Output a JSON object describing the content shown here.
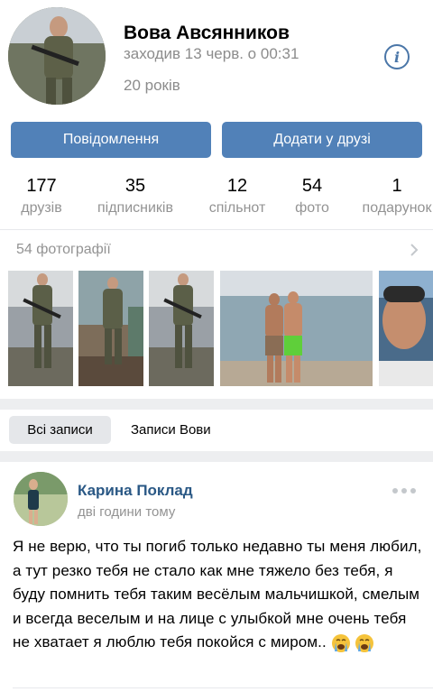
{
  "profile": {
    "name": "Вова Авсянников",
    "last_seen": "заходив 13 черв. о 00:31",
    "age": "20 років",
    "info_icon": "info-icon"
  },
  "actions": {
    "message_label": "Повідомлення",
    "add_friend_label": "Додати у друзі"
  },
  "counters": [
    {
      "value": "177",
      "label": "друзів"
    },
    {
      "value": "35",
      "label": "підписників"
    },
    {
      "value": "12",
      "label": "спільнот"
    },
    {
      "value": "54",
      "label": "фото"
    },
    {
      "value": "1",
      "label": "подарунок"
    }
  ],
  "photos": {
    "header": "54 фотографії",
    "chevron_icon": "chevron-right-icon"
  },
  "tabs": {
    "all_posts": "Всі записи",
    "user_posts": "Записи Вови"
  },
  "post": {
    "author": "Карина Поклад",
    "time": "дві години тому",
    "text": "Я не верю,  что ты погиб только  недавно ты меня любил, а тут резко  тебя не стало как мне тяжело  без тебя, я буду помнить тебя таким весёлым мальчишкой,  смелым и всегда веселым и на лице с улыбкой мне очень тебя не хватает я люблю тебя покойся с миром..",
    "emojis": [
      "crying-face-icon",
      "crying-face-icon"
    ]
  },
  "colors": {
    "accent": "#5181b8",
    "link": "#2a5885",
    "muted": "#939393",
    "separator": "#edeef0"
  }
}
